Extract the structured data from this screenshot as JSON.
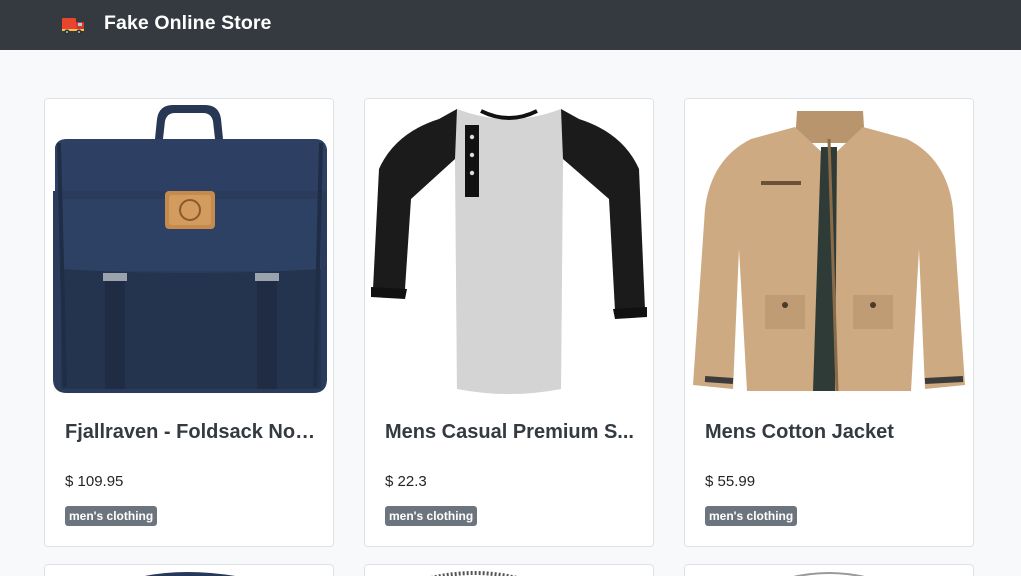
{
  "navbar": {
    "icon": "delivery-truck-icon",
    "title": "Fake Online Store"
  },
  "products": [
    {
      "title": "Fjallraven - Foldsack No....",
      "price": "$ 109.95",
      "category": "men's clothing",
      "image": "backpack"
    },
    {
      "title": "Mens Casual Premium S...",
      "price": "$ 22.3",
      "category": "men's clothing",
      "image": "raglan-henley-shirt"
    },
    {
      "title": "Mens Cotton Jacket",
      "price": "$ 55.99",
      "category": "men's clothing",
      "image": "cotton-jacket"
    }
  ],
  "colors": {
    "navbar_bg": "#343a40",
    "page_bg": "#f8f9fa",
    "badge_bg": "#6c757d",
    "backpack_navy": "#27395a",
    "jacket_khaki": "#cfae88"
  }
}
